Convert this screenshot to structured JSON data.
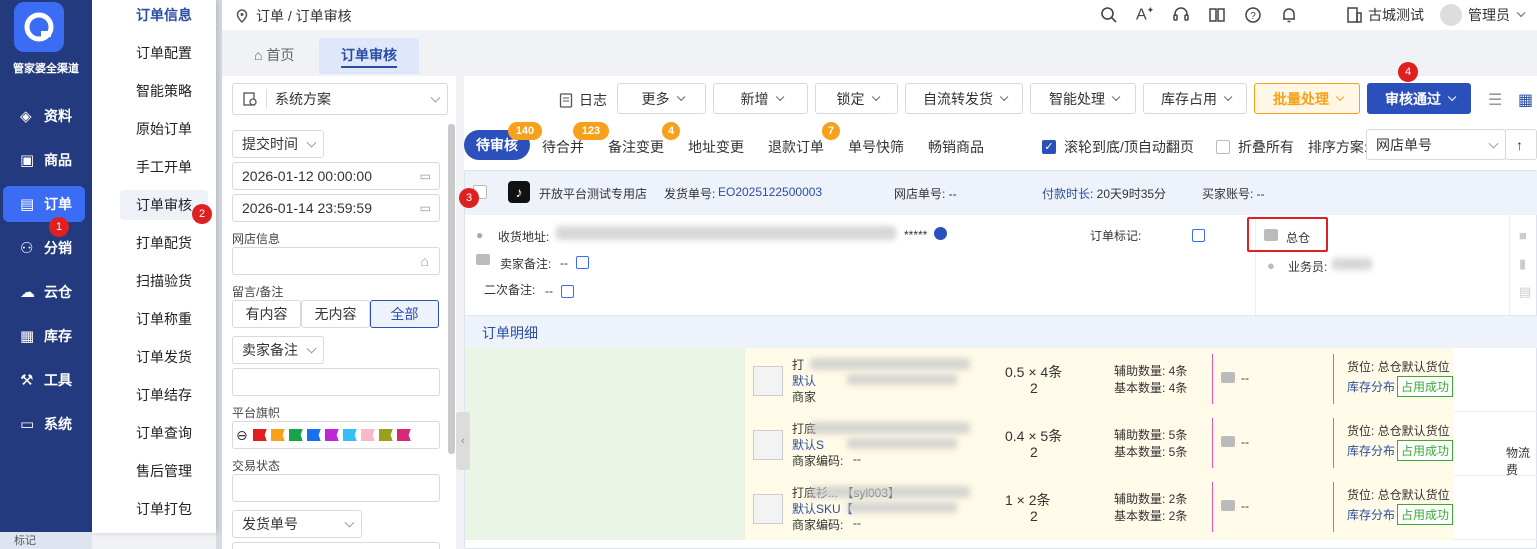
{
  "brand": "管家婆全渠道",
  "nav": [
    {
      "label": "资料",
      "icon": "layers-icon"
    },
    {
      "label": "商品",
      "icon": "box-icon"
    },
    {
      "label": "订单",
      "icon": "document-icon"
    },
    {
      "label": "分销",
      "icon": "network-icon"
    },
    {
      "label": "云仓",
      "icon": "cloud-warehouse-icon"
    },
    {
      "label": "库存",
      "icon": "stock-icon"
    },
    {
      "label": "工具",
      "icon": "toolbox-icon"
    },
    {
      "label": "系统",
      "icon": "monitor-icon"
    }
  ],
  "nav_bottom": "标记",
  "submenu": [
    "订单信息",
    "订单配置",
    "智能策略",
    "原始订单",
    "手工开单",
    "订单审核",
    "打单配货",
    "扫描验货",
    "订单称重",
    "订单发货",
    "订单结存",
    "订单查询",
    "售后管理",
    "订单打包"
  ],
  "steps": [
    "1",
    "2",
    "3",
    "4"
  ],
  "breadcrumb": "订单 / 订单审核",
  "top_right": {
    "company": "古城测试",
    "user": "管理员"
  },
  "tabs": {
    "home": "首页",
    "current": "订单审核"
  },
  "filter": {
    "scheme": "系统方案",
    "time_type": "提交时间",
    "start": "2026-01-12 00:00:00",
    "end": "2026-01-14 23:59:59",
    "shop_label": "网店信息",
    "memo_label": "留言/备注",
    "memo_opts": [
      "有内容",
      "无内容",
      "全部"
    ],
    "seller_memo": "卖家备注",
    "flag_label": "平台旗帜",
    "flags": [
      "#e02020",
      "#f7a11a",
      "#17a34a",
      "#1a6ff0",
      "#c026d3",
      "#38bdf8",
      "#f9b8c8",
      "#9aa01a",
      "#db2777"
    ],
    "trade_label": "交易状态",
    "ship_no": "发货单号"
  },
  "toolbar": {
    "log": "日志",
    "buttons": [
      "更多",
      "新增",
      "锁定",
      "自流转发货",
      "智能处理",
      "库存占用"
    ],
    "batch": "批量处理",
    "approve": "审核通过"
  },
  "subtabs": [
    {
      "label": "待审核",
      "badge": "140"
    },
    {
      "label": "待合并",
      "badge": "123"
    },
    {
      "label": "备注变更",
      "badge": "4"
    },
    {
      "label": "地址变更",
      "badge": ""
    },
    {
      "label": "退款订单",
      "badge": "7"
    },
    {
      "label": "单号快筛",
      "badge": ""
    },
    {
      "label": "畅销商品",
      "badge": ""
    }
  ],
  "options": {
    "scroll": "滚轮到底/顶自动翻页",
    "fold": "折叠所有",
    "sort_label": "排序方案:",
    "sort_value": "网店单号"
  },
  "order": {
    "shop": "开放平台测试专用店",
    "ship_label": "发货单号:",
    "ship_no": "EO2025122500003",
    "shop_no": "网店单号: --",
    "pay_label": "付款时长",
    "pay_value": ": 20天9时35分",
    "buyer": "买家账号: --",
    "addr_label": "收货地址:",
    "addr_mask": "*****",
    "seller_note_label": "卖家备注:",
    "seller_note": "--",
    "second_note_label": "二次备注:",
    "second_note": "--",
    "mark_label": "订单标记:",
    "warehouse": "总仓",
    "salesman": "业务员:",
    "detail_title": "订单明细"
  },
  "items": [
    {
      "title": "打",
      "tag": "默认",
      "code_label": "商家",
      "code": "",
      "qty": "0.5 × 4条",
      "qty2": "2",
      "aux": "辅助数量:  4条",
      "base": "基本数量:  4条",
      "memo": "--",
      "loc": "货位:  总仓默认货位",
      "dist": "库存分布",
      "status": "占用成功"
    },
    {
      "title": "打底",
      "tag": "默认S",
      "code_label": "商家编码:",
      "code": "--",
      "qty": "0.4 × 5条",
      "qty2": "2",
      "aux": "辅助数量:  5条",
      "base": "基本数量:  5条",
      "memo": "--",
      "loc": "货位:  总仓默认货位",
      "dist": "库存分布",
      "status": "占用成功"
    },
    {
      "title": "打底衫...  【syl003】",
      "tag": "默认SKU【",
      "code_label": "商家编码:",
      "code": "--",
      "qty": "1 × 2条",
      "qty2": "2",
      "aux": "辅助数量:  2条",
      "base": "基本数量:  2条",
      "memo": "--",
      "loc": "货位:  总仓默认货位",
      "dist": "库存分布",
      "status": "占用成功"
    }
  ],
  "logistics": "物流费"
}
